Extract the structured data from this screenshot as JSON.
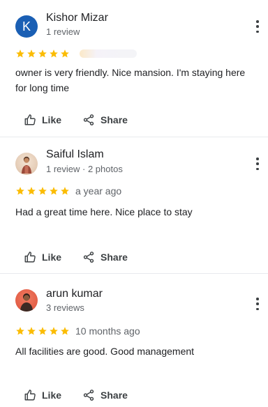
{
  "reviews": [
    {
      "reviewer": "Kishor Mizar",
      "avatar_letter": "K",
      "meta": "1 review",
      "rating": 5,
      "date": "",
      "text": "owner is very friendly. Nice mansion. I'm staying here for long time",
      "like_label": "Like",
      "share_label": "Share"
    },
    {
      "reviewer": "Saiful Islam",
      "avatar_letter": "",
      "meta": "1 review · 2 photos",
      "rating": 5,
      "date": "a year ago",
      "text": "Had a great time here. Nice place to stay",
      "like_label": "Like",
      "share_label": "Share"
    },
    {
      "reviewer": "arun kumar",
      "avatar_letter": "",
      "meta": "3 reviews",
      "rating": 5,
      "date": "10 months ago",
      "text": "All facilities are good. Good management",
      "like_label": "Like",
      "share_label": "Share"
    }
  ],
  "colors": {
    "star": "#fbbc04",
    "avatar_letter_bg": "#1a5fb4",
    "text": "#202124",
    "secondary_text": "#5f6368",
    "divider": "#e8eaed"
  },
  "icons": {
    "like": "thumb-up-outline-icon",
    "share": "share-icon",
    "menu": "more-vert-icon",
    "star": "star-filled-icon"
  }
}
